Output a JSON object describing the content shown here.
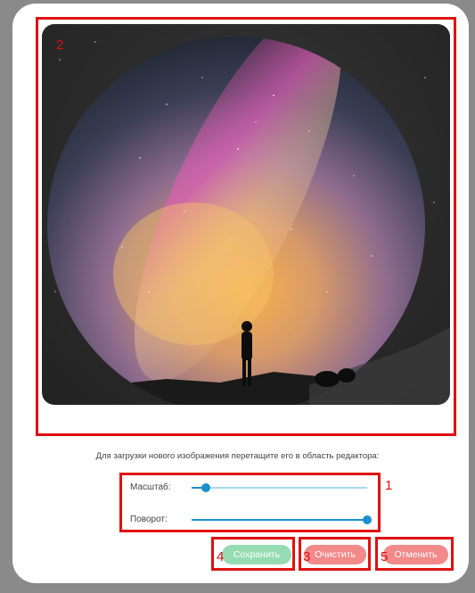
{
  "editor": {
    "hint": "Для загрузки нового изображения перетащите его в область редактора:"
  },
  "controls": {
    "scale_label": "Масштаб:",
    "scale_value": 0.08,
    "rotation_label": "Поворот:",
    "rotation_value": 1.0
  },
  "buttons": {
    "save": "Сохранить",
    "clear": "Очистить",
    "cancel": "Отменить"
  },
  "annotations": {
    "n1": "1",
    "n2": "2",
    "n3": "3",
    "n4": "4",
    "n5": "5"
  },
  "colors": {
    "save": "#95dcb3",
    "danger": "#f28a8a",
    "slider": "#1a8fd0",
    "annotation": "#e01010"
  }
}
